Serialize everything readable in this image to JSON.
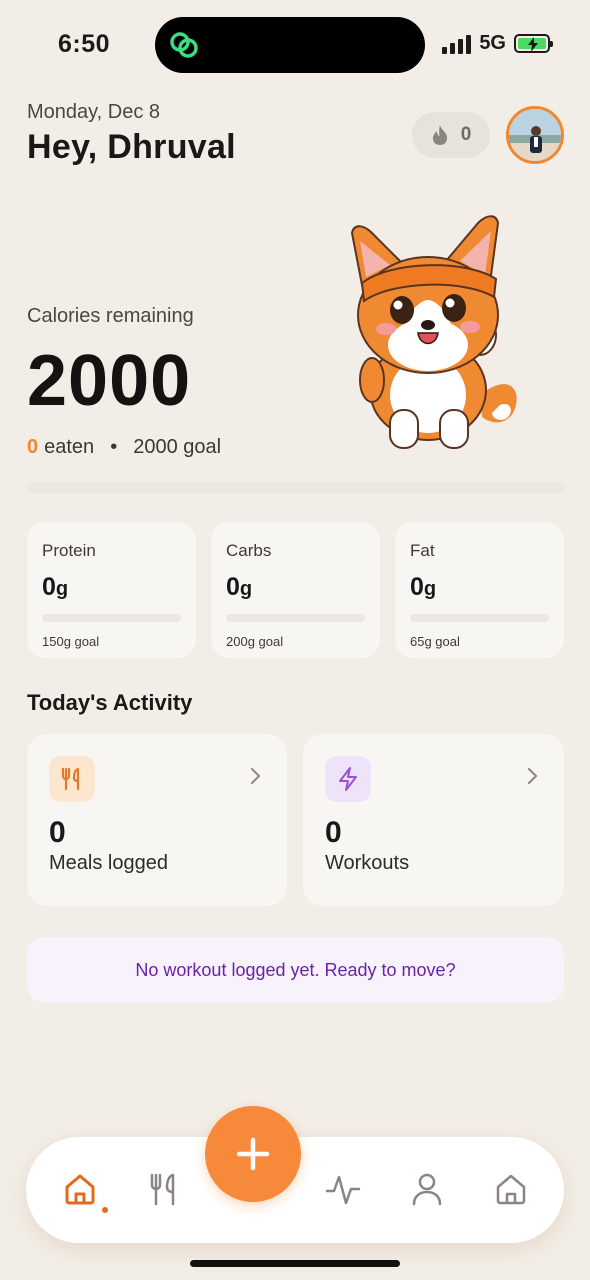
{
  "status_bar": {
    "time": "6:50",
    "network": "5G"
  },
  "header": {
    "date": "Monday, Dec 8",
    "greeting": "Hey, Dhruval",
    "streak_count": "0"
  },
  "calories": {
    "label": "Calories remaining",
    "remaining": "2000",
    "eaten_value": "0",
    "eaten_label": "eaten",
    "separator": "•",
    "goal_text": "2000 goal",
    "progress_fraction": 0
  },
  "macros": [
    {
      "name": "Protein",
      "value": "0",
      "unit": "g",
      "goal": "150g goal",
      "progress_fraction": 0
    },
    {
      "name": "Carbs",
      "value": "0",
      "unit": "g",
      "goal": "200g goal",
      "progress_fraction": 0
    },
    {
      "name": "Fat",
      "value": "0",
      "unit": "g",
      "goal": "65g goal",
      "progress_fraction": 0
    }
  ],
  "activity": {
    "title": "Today's Activity",
    "cards": [
      {
        "value": "0",
        "label": "Meals logged",
        "icon": "fork-knife-icon"
      },
      {
        "value": "0",
        "label": "Workouts",
        "icon": "lightning-icon"
      }
    ]
  },
  "banner": {
    "text": "No workout logged yet. Ready to move?"
  },
  "nav": {
    "items": [
      "home-icon",
      "meals-icon",
      "add-icon",
      "activity-icon",
      "profile-icon",
      "house-icon"
    ],
    "active": "home"
  },
  "colors": {
    "accent": "#f6893a",
    "background": "#f2eee7",
    "card": "#f8f6f3",
    "purple": "#6b21a8"
  }
}
